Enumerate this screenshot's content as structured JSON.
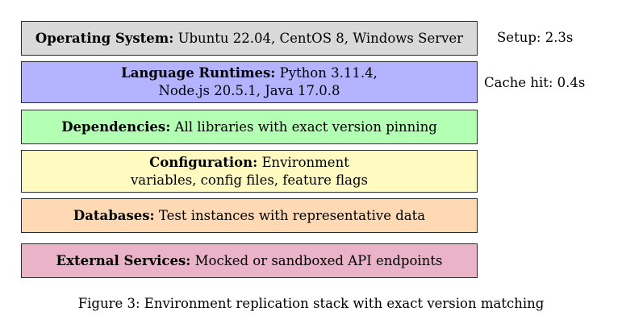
{
  "layers": [
    {
      "title": "Operating System:",
      "description": "Ubuntu 22.04, CentOS 8, Windows Server",
      "color": "#d9d9d9"
    },
    {
      "title": "Language Runtimes:",
      "description": "Python 3.11.4, Node.js 20.5.1, Java 17.0.8",
      "color": "#b3b3ff"
    },
    {
      "title": "Dependencies:",
      "description": "All libraries with exact version pinning",
      "color": "#b3ffb3"
    },
    {
      "title": "Configuration:",
      "description": "Environment variables, config files, feature flags",
      "color": "#fffac0"
    },
    {
      "title": "Databases:",
      "description": "Test instances with representative data",
      "color": "#ffd9b3"
    },
    {
      "title": "External Services:",
      "description": "Mocked or sandboxed API endpoints",
      "color": "#ebb3c7"
    }
  ],
  "notes": {
    "setup": "Setup: 2.3s",
    "cache": "Cache hit: 0.4s"
  },
  "caption": "Figure 3: Environment replication stack with exact version matching"
}
